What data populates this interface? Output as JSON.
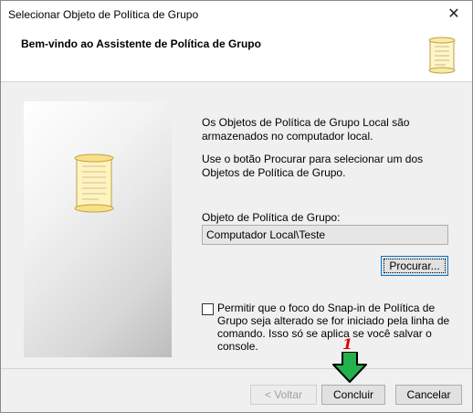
{
  "window": {
    "title": "Selecionar Objeto de Política de Grupo",
    "close_label": "✕"
  },
  "header": {
    "title": "Bem-vindo ao Assistente de Política de Grupo",
    "icon": "scroll-icon"
  },
  "main": {
    "intro_text": "Os Objetos de Política de Grupo Local são armazenados no computador local.",
    "instruction_text": "Use o botão Procurar para selecionar um dos Objetos de Política de Grupo.",
    "gpo_label": "Objeto de Política de Grupo:",
    "gpo_value": "Computador Local\\Teste",
    "browse_label": "Procurar...",
    "checkbox_label": "Permitir que o foco do Snap-in de Política de Grupo seja alterado se for iniciado pela linha de comando. Isso só se aplica se você salvar o console.",
    "checkbox_checked": false
  },
  "footer": {
    "back_label": "< Voltar",
    "finish_label": "Concluir",
    "cancel_label": "Cancelar"
  },
  "annotation": {
    "step_number": "1",
    "arrow_color": "#22b14c",
    "number_color": "#e00000"
  }
}
